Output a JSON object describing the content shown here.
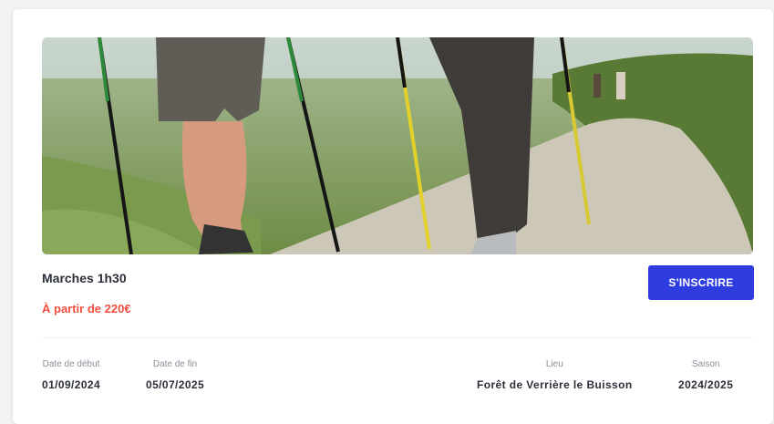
{
  "card": {
    "image_alt": "Marche nordique",
    "title": "Marches 1h30",
    "price": "À partir de 220€",
    "button_label": "S'INSCRIRE",
    "details": [
      {
        "label": "Date de début",
        "value": "01/09/2024"
      },
      {
        "label": "Date de fin",
        "value": "05/07/2025"
      },
      {
        "label": "Lieu",
        "value": "Forêt de Verrière le Buisson"
      },
      {
        "label": "Saison",
        "value": "2024/2025"
      }
    ]
  },
  "colors": {
    "accent": "#2f3de0",
    "price": "#f04e3e",
    "text": "#2b2f3a",
    "muted": "#8a8f99"
  }
}
